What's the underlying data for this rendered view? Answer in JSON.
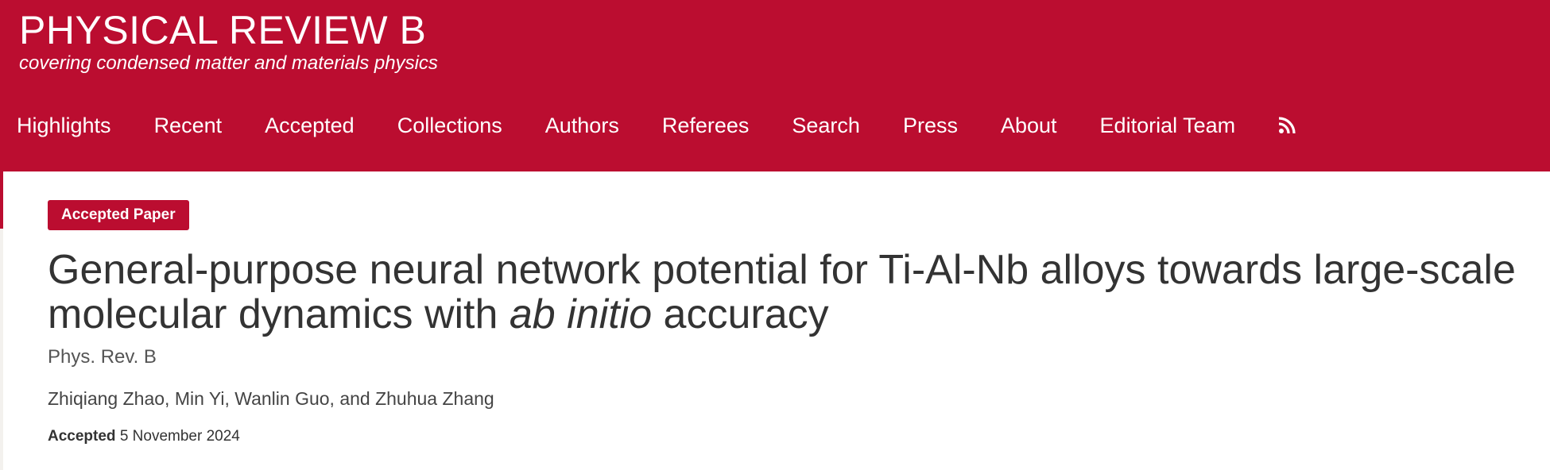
{
  "header": {
    "journal_title": "PHYSICAL REVIEW B",
    "tagline": "covering condensed matter and materials physics",
    "brand_color": "#bb0d30"
  },
  "nav": {
    "items": [
      {
        "label": "Highlights"
      },
      {
        "label": "Recent"
      },
      {
        "label": "Accepted"
      },
      {
        "label": "Collections"
      },
      {
        "label": "Authors"
      },
      {
        "label": "Referees"
      },
      {
        "label": "Search"
      },
      {
        "label": "Press"
      },
      {
        "label": "About"
      },
      {
        "label": "Editorial Team"
      }
    ],
    "rss_icon": "rss-icon"
  },
  "article": {
    "badge": "Accepted Paper",
    "title_part1": "General-purpose neural network potential for Ti-Al-Nb alloys towards large-scale molecular dynamics with ",
    "title_italic": "ab initio",
    "title_part2": " accuracy",
    "journal_ref": "Phys. Rev. B",
    "authors": "Zhiqiang Zhao, Min Yi, Wanlin Guo, and Zhuhua Zhang",
    "accepted_label": "Accepted",
    "accepted_date": "5 November 2024"
  }
}
